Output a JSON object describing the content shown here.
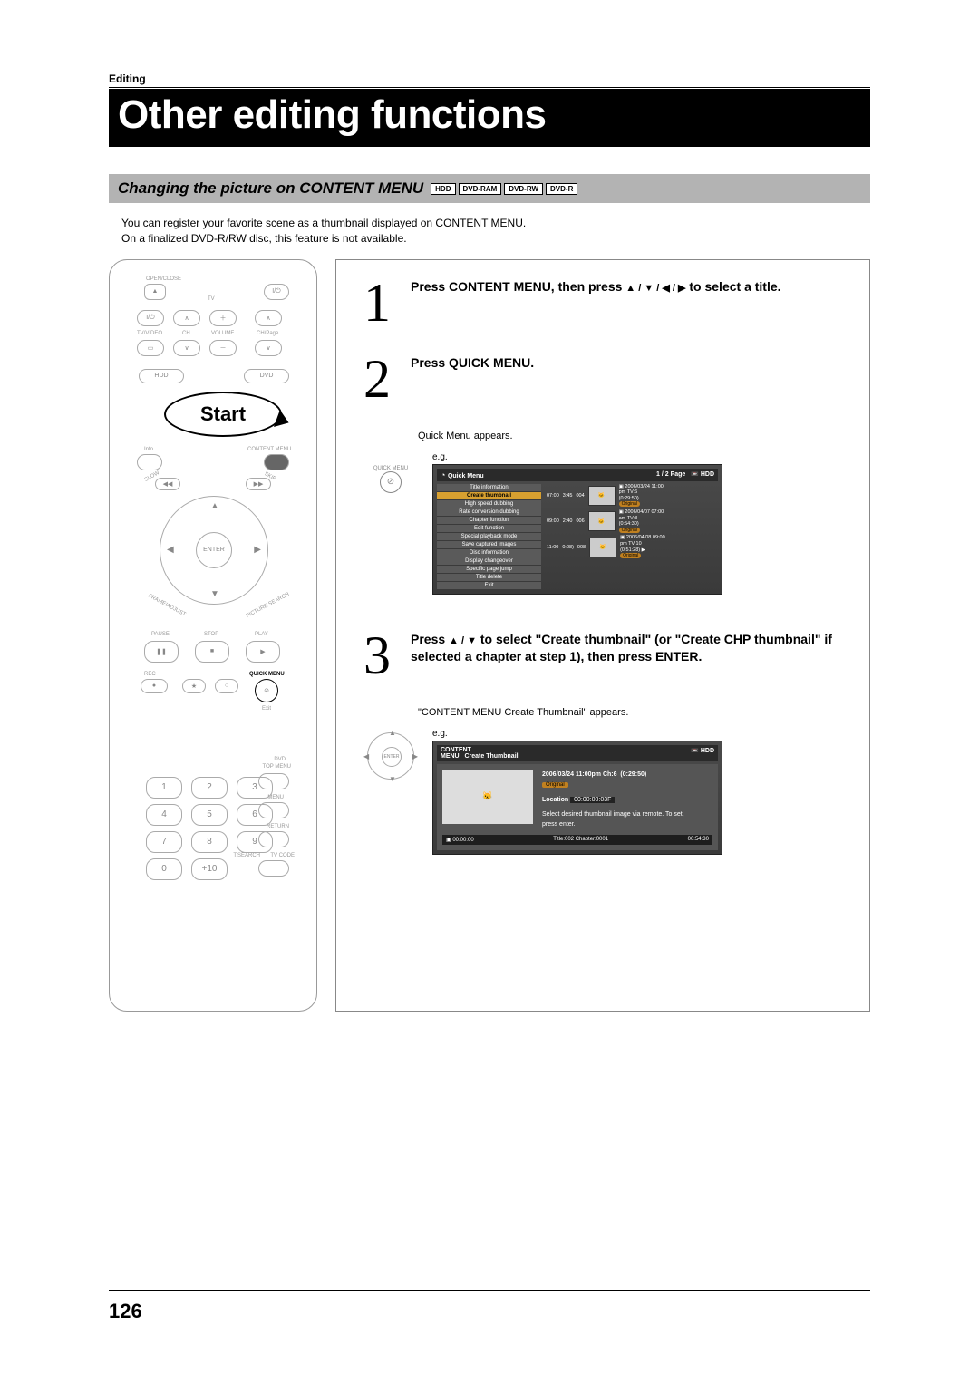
{
  "section_label": "Editing",
  "title": "Other editing functions",
  "subheading": "Changing the picture on CONTENT MENU",
  "badges": [
    "HDD",
    "DVD-RAM",
    "DVD-RW",
    "DVD-R"
  ],
  "intro_line1": "You can register your favorite scene as a thumbnail displayed on CONTENT MENU.",
  "intro_line2": "On a finalized DVD-R/RW disc, this feature is not available.",
  "page_number": "126",
  "remote": {
    "start": "Start",
    "open_close": "OPEN/CLOSE",
    "tv": "TV",
    "tv_video": "TV/VIDEO",
    "ch": "CH",
    "volume": "VOLUME",
    "ch_page": "CH/Page",
    "hdd": "HDD",
    "dvd": "DVD",
    "info": "Info",
    "content_menu": "CONTENT MENU",
    "slow": "SLOW",
    "skip": "SKIP",
    "enter": "ENTER",
    "frame_adjust": "FRAME/ADJUST",
    "picture_search": "PICTURE SEARCH",
    "pause": "PAUSE",
    "stop": "STOP",
    "play": "PLAY",
    "rec": "REC",
    "quick_menu": "QUICK MENU",
    "exit": "Exit",
    "dvd_label": "DVD",
    "top_menu": "TOP MENU",
    "menu": "MENU",
    "return": "RETURN",
    "t_search": "T.SEARCH",
    "tv_code": "TV CODE",
    "plus10": "+10",
    "numpad": [
      "1",
      "2",
      "3",
      "4",
      "5",
      "6",
      "7",
      "8",
      "9",
      "0"
    ]
  },
  "steps": {
    "s1": {
      "num": "1",
      "head_a": "Press CONTENT MENU, then press ",
      "head_arrows": "▲ / ▼ / ◀ / ▶",
      "head_b": " to select a title."
    },
    "s2": {
      "num": "2",
      "head": "Press QUICK MENU.",
      "sub": "Quick Menu appears.",
      "quick_menu_label": "QUICK MENU",
      "eg": "e.g."
    },
    "s3": {
      "num": "3",
      "head_a": "Press ",
      "head_arrows": "▲ / ▼",
      "head_b": " to select \"Create thumbnail\" (or \"Create CHP thumbnail\" if selected a chapter at step 1), then press ENTER.",
      "sub": "\"CONTENT MENU Create Thumbnail\" appears.",
      "enter": "ENTER",
      "eg": "e.g."
    }
  },
  "osd1": {
    "title": "Quick Menu",
    "page": "1 / 2  Page",
    "drive": "HDD",
    "menu": [
      "Title information",
      "Create thumbnail",
      "High speed dubbing",
      "Rate conversion dubbing",
      "Chapter function",
      "Edit function",
      "Special playback mode",
      "Save captured images",
      "Disc information",
      "Display changeover",
      "Specific page jump",
      "Title delete",
      "Exit"
    ],
    "highlighted": "Create thumbnail",
    "entries": [
      {
        "idx": "004",
        "t": "07:00",
        "dur": "3:45",
        "date": "2006/03/24 11:00",
        "ch": "pm  TV:6",
        "len": "(0:29:50)",
        "orig": "Original"
      },
      {
        "idx": "006",
        "t": "09:00",
        "dur": "2:40",
        "date": "2006/04/07 07:00",
        "ch": "am  TV:8",
        "len": "(0:54:30)",
        "orig": "Original"
      },
      {
        "idx": "008",
        "t": "11:00",
        "dur": "0:08)",
        "date": "2006/04/08 09:00",
        "ch": "pm  TV:10",
        "len": "(0:51:28) ▶",
        "orig": "Original"
      }
    ]
  },
  "osd2": {
    "title_a": "CONTENT",
    "title_b": "MENU",
    "subtitle": "Create Thumbnail",
    "drive": "HDD",
    "date": "2006/03/24 11:00pm  Ch:6",
    "len": "(0:29:50)",
    "orig": "Original",
    "loc_label": "Location",
    "loc_val": "00:00:00:03F",
    "instr": "Select desired thumbnail image via remote. To set, press enter.",
    "bar_left": "00:00:00",
    "bar_mid": "Title:002    Chapter:0001",
    "bar_right": "00:54:30"
  }
}
